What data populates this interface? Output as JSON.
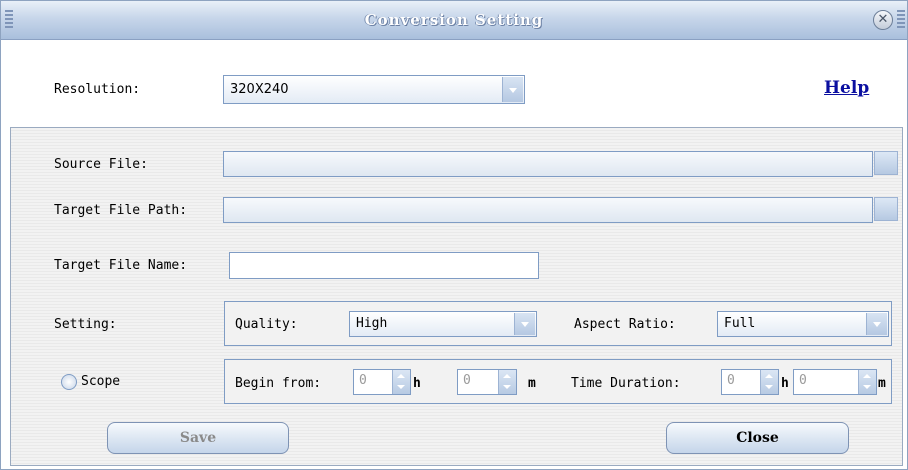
{
  "window": {
    "title": "Conversion Setting"
  },
  "top": {
    "resolution_label": "Resolution:",
    "resolution_value": "320X240",
    "help_link": "Help"
  },
  "form": {
    "source_label": "Source File:",
    "source_value": "",
    "target_path_label": "Target File Path:",
    "target_path_value": "",
    "target_name_label": "Target File Name:",
    "target_name_value": ""
  },
  "setting": {
    "label": "Setting:",
    "quality_label": "Quality:",
    "quality_value": "High",
    "aspect_label": "Aspect Ratio:",
    "aspect_value": "Full"
  },
  "scope": {
    "label": "Scope",
    "begin_label": "Begin from:",
    "begin_h": "0",
    "h_unit": "h",
    "begin_m": "0",
    "m_unit": "m",
    "duration_label": "Time Duration:",
    "duration_h": "0",
    "duration_m": "0"
  },
  "buttons": {
    "save": "Save",
    "close": "Close"
  },
  "colors": {
    "title_bar": "#b7c9e2",
    "help_link": "#0b0fa0",
    "border": "#7f9cc4"
  },
  "icons": {
    "close": "close-icon",
    "dropdown": "chevron-down-icon",
    "spinner": "spinner-arrows-icon"
  }
}
